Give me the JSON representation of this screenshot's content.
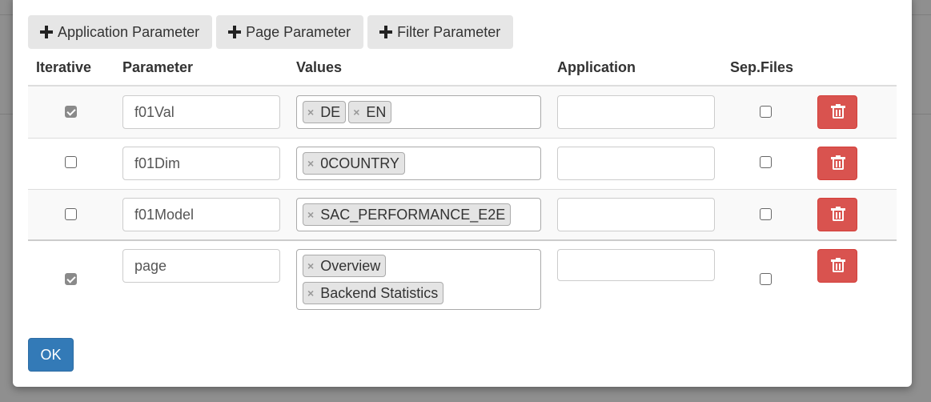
{
  "toolbar": {
    "add_application_parameter": "Application Parameter",
    "add_page_parameter": "Page Parameter",
    "add_filter_parameter": "Filter Parameter"
  },
  "table": {
    "headers": {
      "iterative": "Iterative",
      "parameter": "Parameter",
      "values": "Values",
      "application": "Application",
      "sep_files": "Sep.Files"
    },
    "rows": [
      {
        "iterative": true,
        "parameter": "f01Val",
        "values": [
          "DE",
          "EN"
        ],
        "application": "",
        "sep_files": false
      },
      {
        "iterative": false,
        "parameter": "f01Dim",
        "values": [
          "0COUNTRY"
        ],
        "application": "",
        "sep_files": false
      },
      {
        "iterative": false,
        "parameter": "f01Model",
        "values": [
          "SAC_PERFORMANCE_E2E"
        ],
        "application": "",
        "sep_files": false
      },
      {
        "iterative": true,
        "parameter": "page",
        "values": [
          "Overview",
          "Backend Statistics"
        ],
        "application": "",
        "sep_files": false
      }
    ]
  },
  "footer": {
    "ok_label": "OK"
  },
  "icons": {
    "add": "plus-icon",
    "delete": "trash-icon",
    "remove_tag": "close-icon"
  },
  "colors": {
    "danger": "#d9534f",
    "primary": "#337ab7",
    "checkbox_checked": "#8a8a8a"
  }
}
